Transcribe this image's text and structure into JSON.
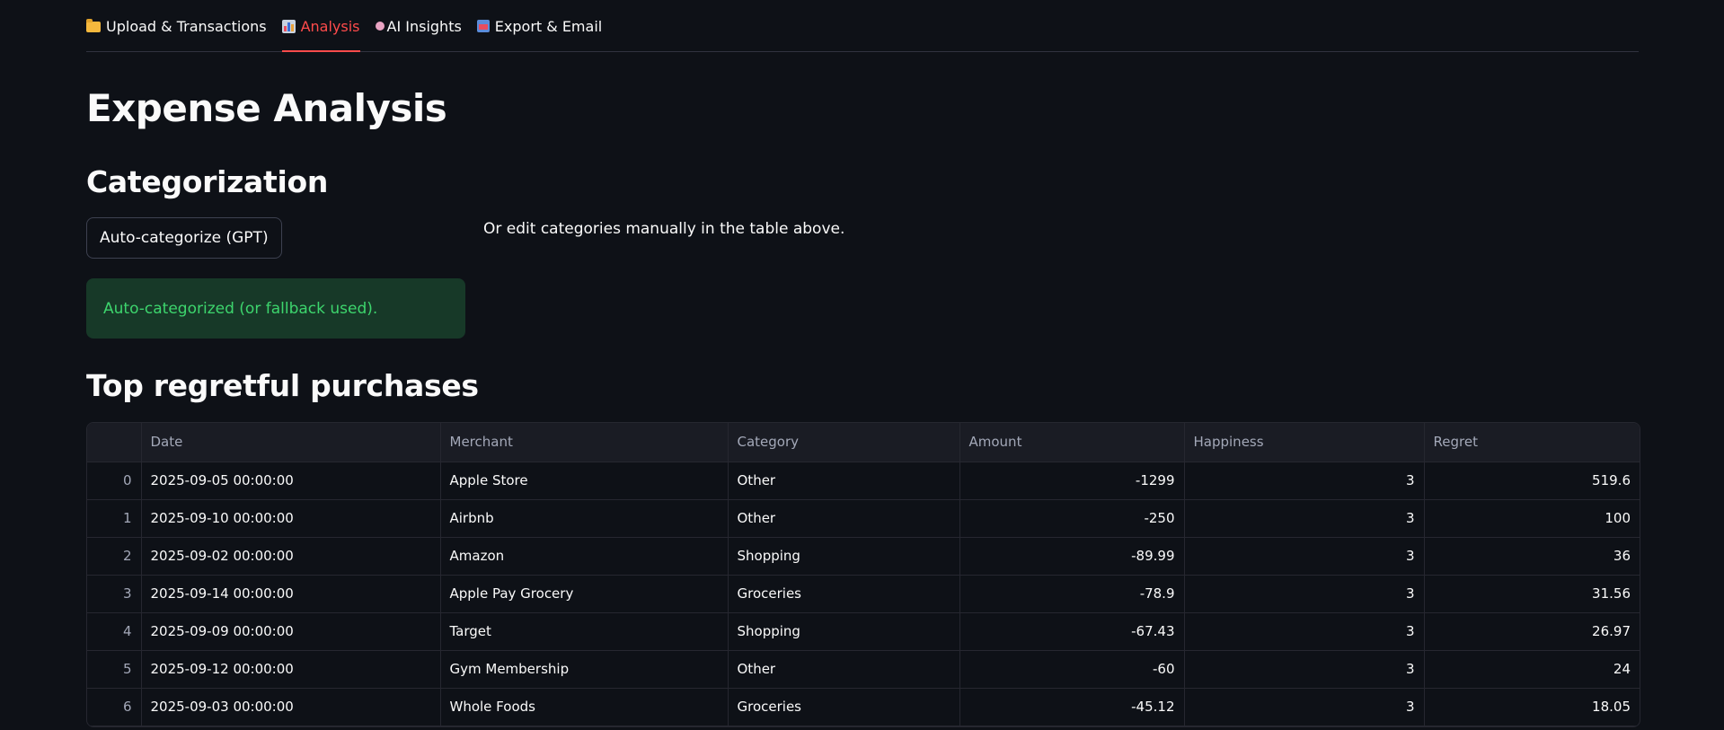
{
  "tabs": [
    {
      "icon": "folder-icon",
      "label": "Upload & Transactions",
      "active": false
    },
    {
      "icon": "bar-chart-icon",
      "label": "Analysis",
      "active": true
    },
    {
      "icon": "brain-icon",
      "label": "AI Insights",
      "active": false
    },
    {
      "icon": "mailbox-icon",
      "label": "Export & Email",
      "active": false
    }
  ],
  "page": {
    "title": "Expense Analysis"
  },
  "categorization": {
    "heading": "Categorization",
    "button_label": "Auto-categorize (GPT)",
    "hint": "Or edit categories manually in the table above.",
    "success_message": "Auto-categorized (or fallback used)."
  },
  "regretful": {
    "heading": "Top regretful purchases",
    "columns": [
      "",
      "Date",
      "Merchant",
      "Category",
      "Amount",
      "Happiness",
      "Regret"
    ],
    "rows": [
      {
        "index": "0",
        "date": "2025-09-05 00:00:00",
        "merchant": "Apple Store",
        "category": "Other",
        "amount": "-1299",
        "happiness": "3",
        "regret": "519.6"
      },
      {
        "index": "1",
        "date": "2025-09-10 00:00:00",
        "merchant": "Airbnb",
        "category": "Other",
        "amount": "-250",
        "happiness": "3",
        "regret": "100"
      },
      {
        "index": "2",
        "date": "2025-09-02 00:00:00",
        "merchant": "Amazon",
        "category": "Shopping",
        "amount": "-89.99",
        "happiness": "3",
        "regret": "36"
      },
      {
        "index": "3",
        "date": "2025-09-14 00:00:00",
        "merchant": "Apple Pay Grocery",
        "category": "Groceries",
        "amount": "-78.9",
        "happiness": "3",
        "regret": "31.56"
      },
      {
        "index": "4",
        "date": "2025-09-09 00:00:00",
        "merchant": "Target",
        "category": "Shopping",
        "amount": "-67.43",
        "happiness": "3",
        "regret": "26.97"
      },
      {
        "index": "5",
        "date": "2025-09-12 00:00:00",
        "merchant": "Gym Membership",
        "category": "Other",
        "amount": "-60",
        "happiness": "3",
        "regret": "24"
      },
      {
        "index": "6",
        "date": "2025-09-03 00:00:00",
        "merchant": "Whole Foods",
        "category": "Groceries",
        "amount": "-45.12",
        "happiness": "3",
        "regret": "18.05"
      }
    ]
  },
  "colors": {
    "background": "#0e1117",
    "accent": "#ff4b4b",
    "success_bg": "#173928",
    "success_text": "#3dd56d"
  }
}
